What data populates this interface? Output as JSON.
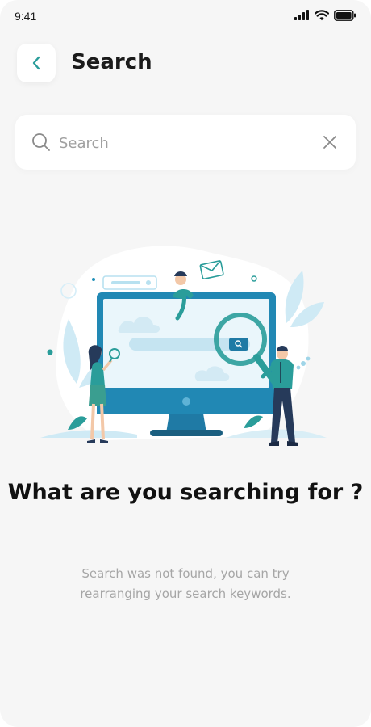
{
  "status_bar": {
    "time": "9:41"
  },
  "header": {
    "title": "Search"
  },
  "search": {
    "placeholder": "Search",
    "value": ""
  },
  "empty_state": {
    "title": "What are you searching for ?",
    "description": "Search was not found, you can try rearranging your search keywords."
  },
  "icons": {
    "back": "chevron-left-icon",
    "search": "search-icon",
    "clear": "close-icon",
    "signal": "cellular-signal-icon",
    "wifi": "wifi-icon",
    "battery": "battery-icon"
  },
  "colors": {
    "accent": "#2a9d9a",
    "illustration_blue": "#1f8fb8",
    "background": "#f6f6f6",
    "card": "#ffffff",
    "title_text": "#111111",
    "muted_text": "#a6a6a6"
  }
}
